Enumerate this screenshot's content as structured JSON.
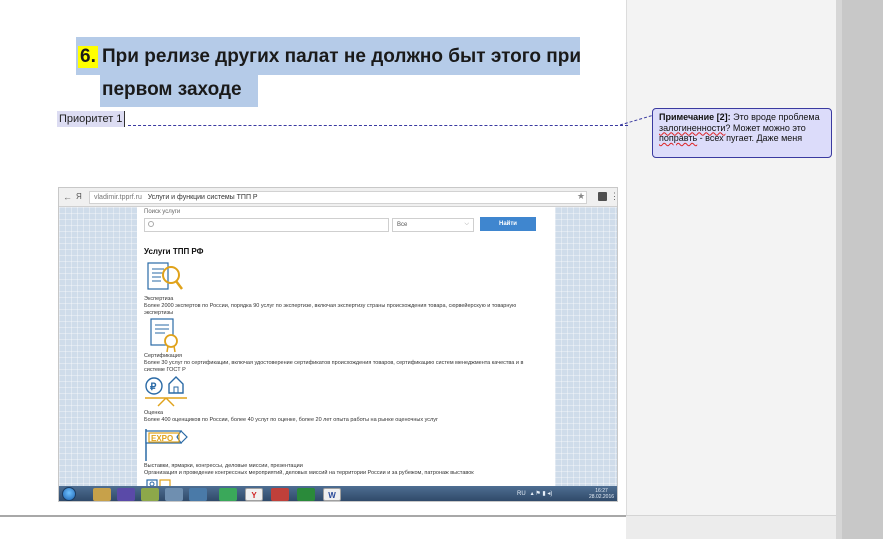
{
  "document": {
    "heading_number": "6.",
    "heading_line1": "При релизе других палат не должно быт этого при",
    "heading_line2": "первом заходе",
    "priority_text": "Приоритет 1"
  },
  "comment": {
    "label": "Примечание [2]:",
    "text_before": " Это вроде проблема ",
    "misspelled_1": "залогиненности",
    "text_middle": "? Может можно это ",
    "misspelled_2": "поправть",
    "text_after": " - всех пугает. Даже меня"
  },
  "screenshot": {
    "browser": {
      "back": "←",
      "ya": "Я",
      "domain": "vladimir.tpprf.ru",
      "page_title": "Услуги и функции системы ТПП Р",
      "star": "★"
    },
    "search": {
      "label": "Поиск услуги",
      "select_value": "Все",
      "find_button": "Найти"
    },
    "services_title": "Услуги ТПП РФ",
    "services": [
      {
        "name": "Экспертиза",
        "description": "Более 2000 экспертов по России, порядка 90 услуг по экспертизе, включая экспертизу страны происхождения товара, сюрвейерскую и товарную экспертизы"
      },
      {
        "name": "Сертификация",
        "description": "Более 30 услуг по сертификации, включая удостоверение сертификатов происхождения товаров, сертификацию систем менеджмента качества и в системе ГОСТ Р"
      },
      {
        "name": "Оценка",
        "description": "Более 400 оценщиков по России, более 40 услуг по оценке, более 20 лет опыта работы на рынке оценочных услуг"
      },
      {
        "name": "Выставки, ярмарки, конгрессы, деловые миссии, презентации",
        "description": "Организация и проведение конгрессных мероприятий, деловых миссий на территории России и за рубежом, патронаж выставок"
      }
    ],
    "expo_label": "EXPO",
    "taskbar": {
      "items": [
        "",
        "",
        "",
        "",
        "",
        "",
        "Y",
        "",
        "",
        "W"
      ],
      "lang": "RU",
      "time": "16:27",
      "date": "28.02.2016"
    },
    "colors": {
      "accent_blue": "#3f86cf",
      "icon_gold": "#e0a21a",
      "icon_blue": "#2a6aa6"
    }
  }
}
